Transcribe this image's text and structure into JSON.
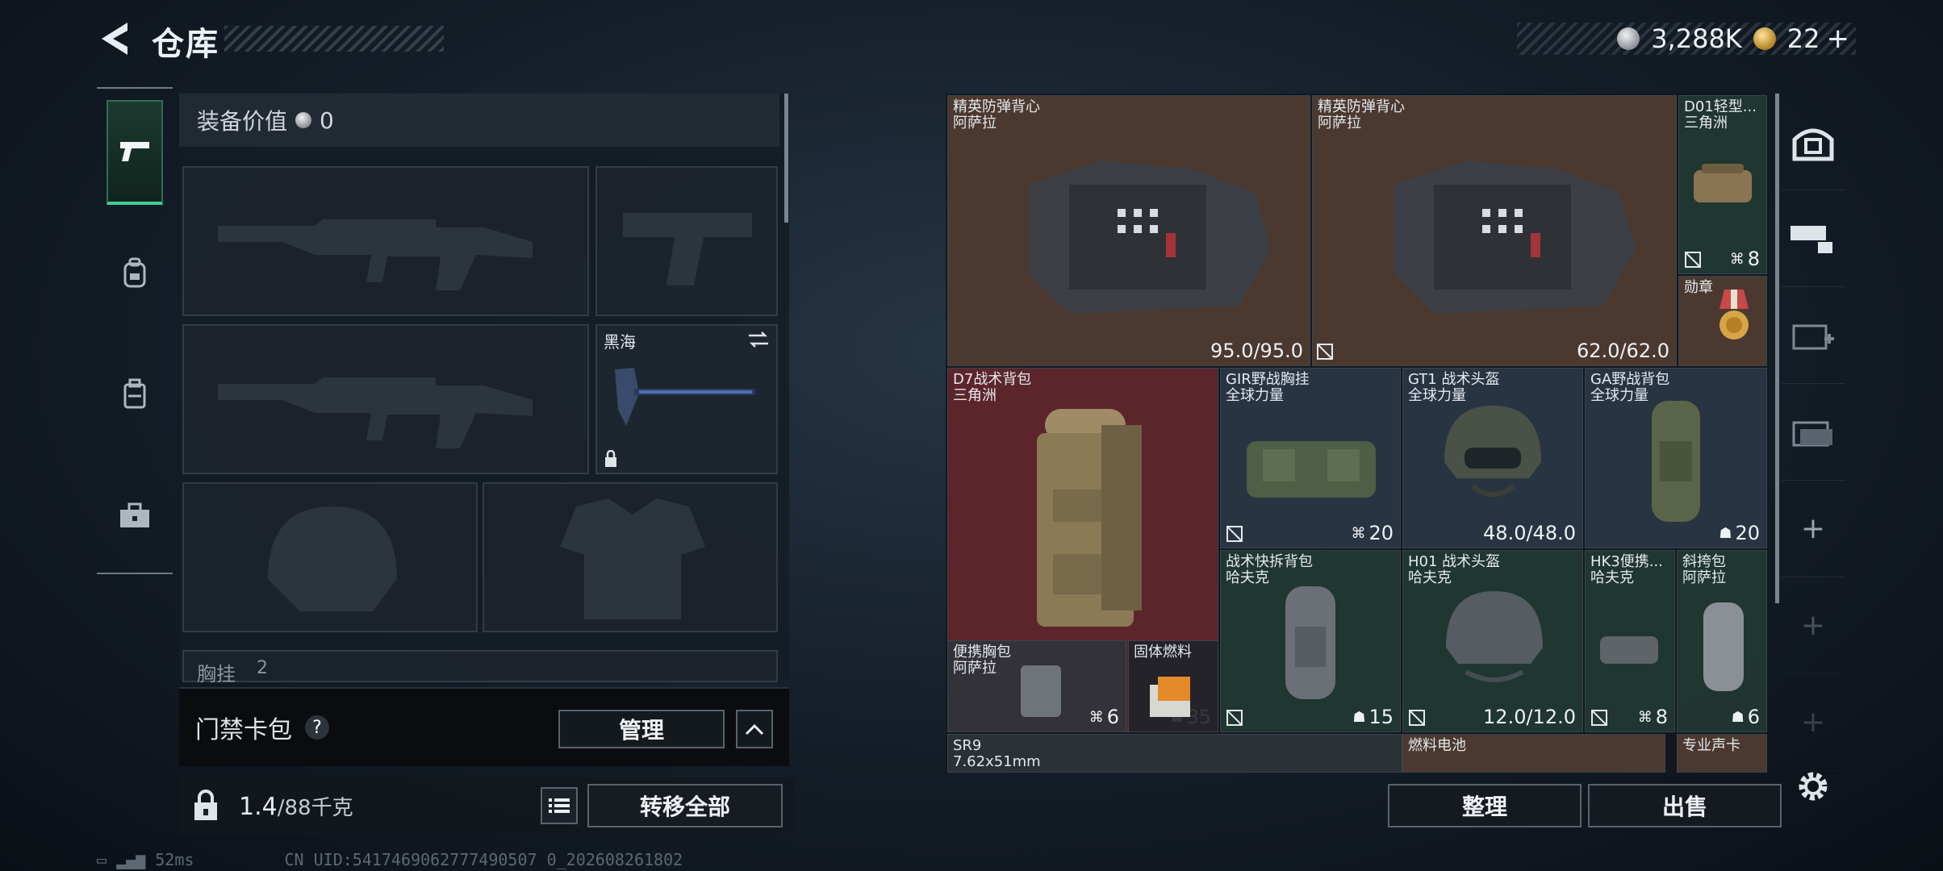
{
  "header": {
    "title": "仓库",
    "currency_value": "3,288K",
    "ticket_count": "22",
    "plus": "+"
  },
  "left_tabs": [
    "weapons",
    "backpack",
    "vest",
    "toolbox"
  ],
  "loadout": {
    "equip_value_label": "装备价值",
    "equip_value": "0",
    "melee_name": "黑海",
    "chest_label": "胸挂",
    "chest_count": "2"
  },
  "keycard": {
    "title": "门禁卡包",
    "help": "?",
    "manage_label": "管理"
  },
  "capacity": {
    "weight": "1.4",
    "max": "/88千克",
    "transfer_label": "转移全部"
  },
  "stash": {
    "items": [
      {
        "id": "vest1",
        "name": "精英防弹背心",
        "sub": "阿萨拉",
        "value": "95.0/95.0"
      },
      {
        "id": "vest2",
        "name": "精英防弹背心",
        "sub": "阿萨拉",
        "value": "62.0/62.0"
      },
      {
        "id": "d01",
        "name": "D01轻型...",
        "sub": "三角洲",
        "count": "8"
      },
      {
        "id": "medal",
        "name": "勋章",
        "sub": ""
      },
      {
        "id": "d7",
        "name": "D7战术背包",
        "sub": "三角洲",
        "count": "35"
      },
      {
        "id": "gir",
        "name": "GIR野战胸挂",
        "sub": "全球力量",
        "count": "20"
      },
      {
        "id": "gt1",
        "name": "GT1 战术头盔",
        "sub": "全球力量",
        "value": "48.0/48.0"
      },
      {
        "id": "ga",
        "name": "GA野战背包",
        "sub": "全球力量",
        "count": "20"
      },
      {
        "id": "quickbag",
        "name": "战术快拆背包",
        "sub": "哈夫克",
        "count": "15"
      },
      {
        "id": "h01",
        "name": "H01 战术头盔",
        "sub": "哈夫克",
        "value": "12.0/12.0"
      },
      {
        "id": "hk3",
        "name": "HK3便携...",
        "sub": "哈夫克",
        "count": "8"
      },
      {
        "id": "sling",
        "name": "斜挎包",
        "sub": "阿萨拉",
        "count": "6"
      },
      {
        "id": "chestpack",
        "name": "便携胸包",
        "sub": "阿萨拉",
        "count": "6"
      },
      {
        "id": "fuel",
        "name": "固体燃料",
        "sub": ""
      },
      {
        "id": "sr9",
        "name": "SR9",
        "sub": "7.62x51mm"
      },
      {
        "id": "battery",
        "name": "燃料电池",
        "sub": ""
      },
      {
        "id": "soundcard",
        "name": "专业声卡",
        "sub": ""
      }
    ],
    "sort_label": "整理",
    "sell_label": "出售"
  },
  "status_bar": {
    "ping": "52ms",
    "uid": "CN UID:5417469062777490507 0_202608261802"
  },
  "colors": {
    "accent_green": "#3fcf98",
    "vest_bg": "#564034",
    "backpack_bg": "#6a282e",
    "blue_bg": "#2c3848",
    "green_bg": "#223a34"
  }
}
